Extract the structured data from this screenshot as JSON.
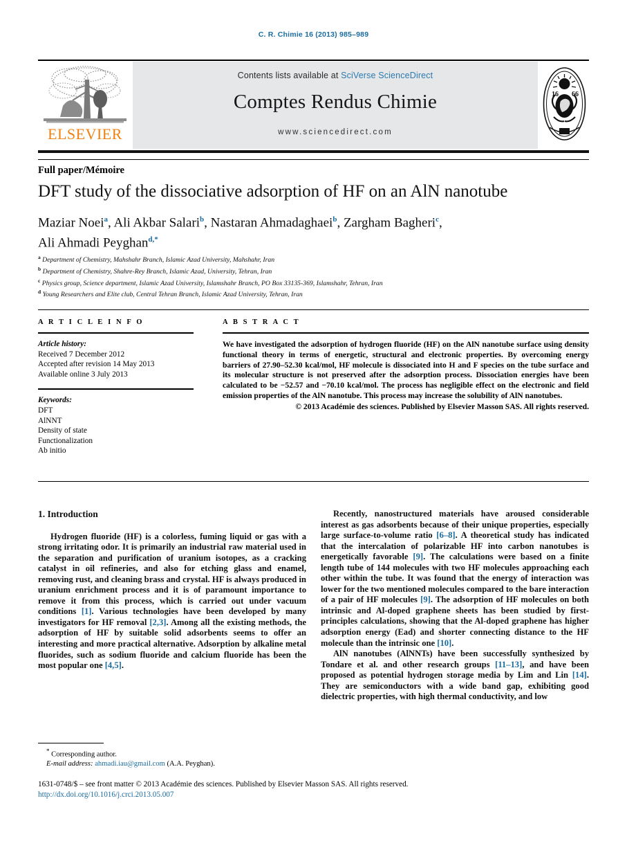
{
  "running_head": "C. R. Chimie 16 (2013) 985–989",
  "masthead": {
    "contents_prefix": "Contents lists available at ",
    "contents_link": "SciVerse ScienceDirect",
    "journal_title": "Comptes Rendus Chimie",
    "journal_url": "www.sciencedirect.com",
    "publisher_name": "ELSEVIER",
    "seal_icon": "academie-des-sciences-seal"
  },
  "article": {
    "section_label": "Full paper/Mémoire",
    "title": "DFT study of the dissociative adsorption of HF on an AlN nanotube",
    "authors_line_1": "Maziar Noei a, Ali Akbar Salari b, Nastaran Ahmadaghaei b, Zargham Bagheri c,",
    "authors_line_2": "Ali Ahmadi Peyghan d,*",
    "authors": [
      {
        "name": "Maziar Noei",
        "marks": "a"
      },
      {
        "name": "Ali Akbar Salari",
        "marks": "b"
      },
      {
        "name": "Nastaran Ahmadaghaei",
        "marks": "b"
      },
      {
        "name": "Zargham Bagheri",
        "marks": "c"
      },
      {
        "name": "Ali Ahmadi Peyghan",
        "marks": "d,*"
      }
    ],
    "affiliations": [
      {
        "mark": "a",
        "text": "Department of Chemistry, Mahshahr Branch, Islamic Azad University, Mahshahr, Iran"
      },
      {
        "mark": "b",
        "text": "Department of Chemistry, Shahre-Rey Branch, Islamic Azad, University, Tehran, Iran"
      },
      {
        "mark": "c",
        "text": "Physics group, Science department, Islamic Azad University, Islamshahr Branch, PO Box 33135-369, Islamshahr, Tehran, Iran"
      },
      {
        "mark": "d",
        "text": "Young Researchers and Elite club, Central Tehran Branch, Islamic Azad University, Tehran, Iran"
      }
    ]
  },
  "article_info": {
    "heading": "A R T I C L E   I N F O",
    "history_label": "Article history:",
    "history": [
      "Received 7 December 2012",
      "Accepted after revision 14 May 2013",
      "Available online 3 July 2013"
    ],
    "keywords_label": "Keywords:",
    "keywords": [
      "DFT",
      "AlNNT",
      "Density of state",
      "Functionalization",
      "Ab initio"
    ]
  },
  "abstract": {
    "heading": "A B S T R A C T",
    "text": "We have investigated the adsorption of hydrogen fluoride (HF) on the AlN nanotube surface using density functional theory in terms of energetic, structural and electronic properties. By overcoming energy barriers of 27.90–52.30 kcal/mol, HF molecule is dissociated into H and F species on the tube surface and its molecular structure is not preserved after the adsorption process. Dissociation energies have been calculated to be −52.57 and −70.10 kcal/mol. The process has negligible effect on the electronic and field emission properties of the AlN nanotube. This process may increase the solubility of AlN nanotubes.",
    "copyright": "© 2013 Académie des sciences. Published by Elsevier Masson SAS. All rights reserved."
  },
  "body": {
    "section_number_title": "1. Introduction",
    "left_paragraph_1_part1": "Hydrogen fluoride (HF) is a colorless, fuming liquid or gas with a strong irritating odor. It is primarily an industrial raw material used in the separation and purification of uranium isotopes, as a cracking catalyst in oil refineries, and also for etching glass and enamel, removing rust, and cleaning brass and crystal. HF is always produced in uranium enrichment process and it is of paramount importance to remove it from this process, which is carried out under vacuum conditions ",
    "ref_1": "[1]",
    "left_paragraph_1_part2": ". Various technologies have been developed by many investigators for HF removal ",
    "ref_2_3": "[2,3]",
    "left_paragraph_1_part3": ". Among all the existing methods, the adsorption of HF by suitable solid adsorbents seems to offer an interesting and more practical alternative. Adsorption by alkaline metal fluorides, such as sodium fluoride and calcium fluoride has been the most popular one ",
    "ref_4_5": "[4,5]",
    "left_paragraph_1_part4": ".",
    "right_paragraph_1_part1": "Recently, nanostructured materials have aroused considerable interest as gas adsorbents because of their unique properties, especially large surface-to-volume ratio ",
    "ref_6_8": "[6–8]",
    "right_paragraph_1_part2": ". A theoretical study has indicated that the intercalation of polarizable HF into carbon nanotubes is energetically favorable ",
    "ref_9a": "[9]",
    "right_paragraph_1_part3": ". The calculations were based on a finite length tube of 144 molecules with two HF molecules approaching each other within the tube. It was found that the energy of interaction was lower for the two mentioned molecules compared to the bare interaction of a pair of HF molecules ",
    "ref_9b": "[9]",
    "right_paragraph_1_part4": ". The adsorption of HF molecules on both intrinsic and Al-doped graphene sheets has been studied by first-principles calculations, showing that the Al-doped graphene has higher adsorption energy (Ead) and shorter connecting distance to the HF molecule than the intrinsic one ",
    "ref_10": "[10]",
    "right_paragraph_1_part5": ".",
    "right_paragraph_2_part1": "AlN nanotubes (AlNNTs) have been successfully synthesized by Tondare et al. and other research groups ",
    "ref_11_13": "[11–13]",
    "right_paragraph_2_part2": ", and have been proposed as potential hydrogen storage media by Lim and Lin ",
    "ref_14": "[14]",
    "right_paragraph_2_part3": ". They are semiconductors with a wide band gap, exhibiting good dielectric properties, with high thermal conductivity, and low"
  },
  "footnote": {
    "marker": "*",
    "corresponding": "Corresponding author.",
    "email_label": "E-mail address:",
    "email": "ahmadi.iau@gmail.com",
    "email_owner": "(A.A. Peyghan)."
  },
  "page_footer": {
    "copyright_line": "1631-0748/$ – see front matter © 2013 Académie des sciences. Published by Elsevier Masson SAS. All rights reserved.",
    "doi": "http://dx.doi.org/10.1016/j.crci.2013.05.007"
  },
  "colors": {
    "link_blue": "#1a6ba0",
    "masthead_gray": "#e6e7e8",
    "elsevier_orange": "#F08010"
  }
}
